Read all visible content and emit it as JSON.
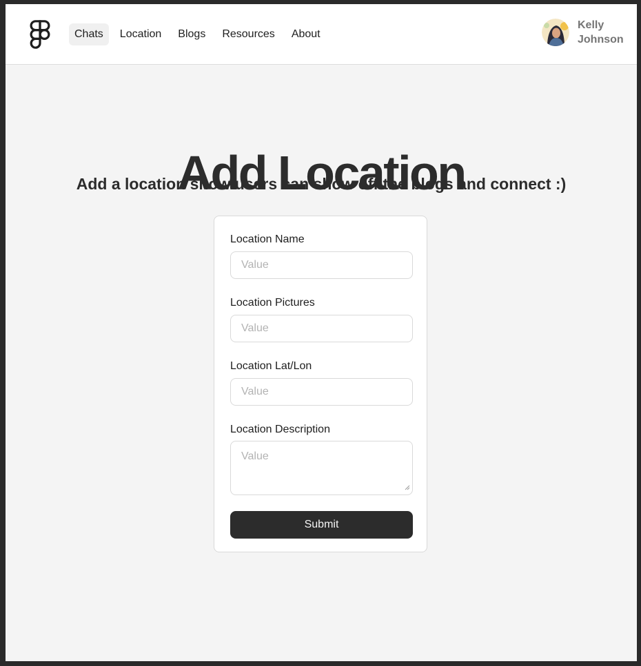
{
  "header": {
    "logo_icon": "figma-logo-icon",
    "nav": [
      {
        "label": "Chats",
        "active": true
      },
      {
        "label": "Location",
        "active": false
      },
      {
        "label": "Blogs",
        "active": false
      },
      {
        "label": "Resources",
        "active": false
      },
      {
        "label": "About",
        "active": false
      }
    ],
    "user": {
      "name": "Kelly Johnson",
      "avatar_icon": "user-avatar"
    }
  },
  "main": {
    "title": "Add Location",
    "subtitle": "Add a location show users can show off the blogs and connect :)"
  },
  "form": {
    "fields": [
      {
        "label": "Location Name",
        "placeholder": "Value",
        "value": ""
      },
      {
        "label": "Location Pictures",
        "placeholder": "Value",
        "value": ""
      },
      {
        "label": "Location Lat/Lon",
        "placeholder": "Value",
        "value": ""
      },
      {
        "label": "Location Description",
        "placeholder": "Value",
        "value": ""
      }
    ],
    "submit_label": "Submit"
  },
  "colors": {
    "background": "#f4f4f4",
    "header_background": "#ffffff",
    "text_primary": "#2c2c2c",
    "text_secondary": "#757575",
    "placeholder": "#b3b3b3",
    "border": "#d9d9d9",
    "button": "#2c2c2c",
    "nav_active": "#f0f0f0",
    "outer_frame": "#2a2a2a"
  }
}
